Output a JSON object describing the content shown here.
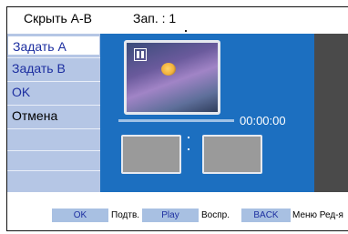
{
  "header": {
    "title": "Скрыть A-B",
    "count": "Зап. : 1"
  },
  "menu": {
    "items": [
      {
        "label": "Задать A",
        "state": "selected"
      },
      {
        "label": "Задать B",
        "state": "normal"
      },
      {
        "label": "OK",
        "state": "normal"
      },
      {
        "label": "Отмена",
        "state": "dim"
      }
    ]
  },
  "preview": {
    "time": "00:00:00",
    "progress": 0,
    "icon": "pause-icon"
  },
  "footer": {
    "ok_label": "OK",
    "ok_hint": "Подтв.",
    "play_label": "Play",
    "play_hint": "Воспр.",
    "back_label": "BACK",
    "back_hint": "Меню Ред-я"
  },
  "colors": {
    "menu_bg": "#b5c6e5",
    "preview_bg": "#1c6fc0",
    "side_dark": "#4a4a4a",
    "accent_text": "#1d2fa0"
  }
}
